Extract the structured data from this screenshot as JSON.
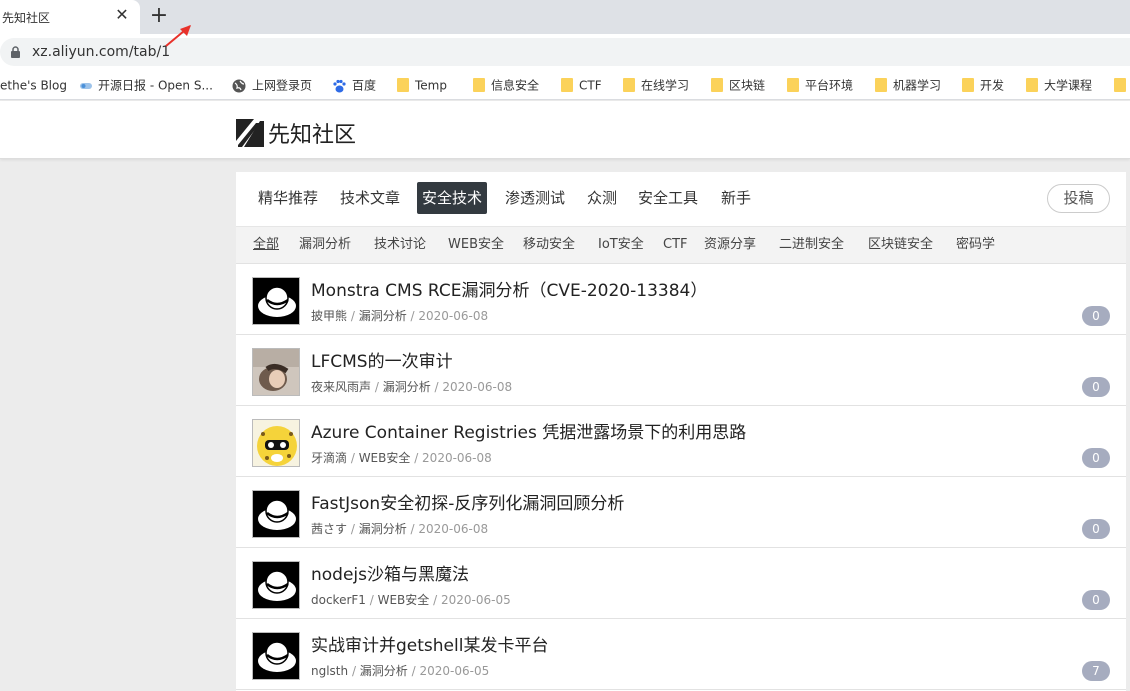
{
  "browser": {
    "tab_title": "先知社区",
    "tab_close": "✕",
    "new_tab": "+",
    "url": "xz.aliyun.com/tab/1",
    "bookmarks": [
      {
        "label": "ethe's Blog",
        "icon": "none"
      },
      {
        "label": "开源日报 - Open S...",
        "icon": "opensource-icon"
      },
      {
        "label": "上网登录页",
        "icon": "globe-icon"
      },
      {
        "label": "百度",
        "icon": "baidu-paw-icon"
      },
      {
        "label": "Temp",
        "icon": "folder-icon"
      },
      {
        "label": "信息安全",
        "icon": "folder-icon"
      },
      {
        "label": "CTF",
        "icon": "folder-icon"
      },
      {
        "label": "在线学习",
        "icon": "folder-icon"
      },
      {
        "label": "区块链",
        "icon": "folder-icon"
      },
      {
        "label": "平台环境",
        "icon": "folder-icon"
      },
      {
        "label": "机器学习",
        "icon": "folder-icon"
      },
      {
        "label": "开发",
        "icon": "folder-icon"
      },
      {
        "label": "大学课程",
        "icon": "folder-icon"
      }
    ]
  },
  "site": {
    "name": "先知社区"
  },
  "nav": {
    "items": [
      "精华推荐",
      "技术文章",
      "安全技术",
      "渗透测试",
      "众测",
      "安全工具",
      "新手"
    ],
    "active": "安全技术",
    "post_button": "投稿"
  },
  "subnav": {
    "items": [
      "全部",
      "漏洞分析",
      "技术讨论",
      "WEB安全",
      "移动安全",
      "IoT安全",
      "CTF",
      "资源分享",
      "二进制安全",
      "区块链安全",
      "密码学"
    ],
    "active": "全部"
  },
  "articles": [
    {
      "title": "Monstra CMS RCE漏洞分析（CVE-2020-13384）",
      "author": "披甲熊",
      "category": "漏洞分析",
      "date": "2020-06-08",
      "comments": "0",
      "avatar": "hat-avatar"
    },
    {
      "title": "LFCMS的一次审计",
      "author": "夜来风雨声",
      "category": "漏洞分析",
      "date": "2020-06-08",
      "comments": "0",
      "avatar": "photo-avatar"
    },
    {
      "title": "Azure Container Registries 凭据泄露场景下的利用思路",
      "author": "牙滴滴",
      "category": "WEB安全",
      "date": "2020-06-08",
      "comments": "0",
      "avatar": "cartoon-avatar"
    },
    {
      "title": "FastJson安全初探-反序列化漏洞回顾分析",
      "author": "茜さす",
      "category": "漏洞分析",
      "date": "2020-06-08",
      "comments": "0",
      "avatar": "hat-avatar"
    },
    {
      "title": "nodejs沙箱与黑魔法",
      "author": "dockerF1",
      "category": "WEB安全",
      "date": "2020-06-05",
      "comments": "0",
      "avatar": "hat-avatar"
    },
    {
      "title": "实战审计并getshell某发卡平台",
      "author": "nglsth",
      "category": "漏洞分析",
      "date": "2020-06-05",
      "comments": "7",
      "avatar": "hat-avatar"
    }
  ],
  "colors": {
    "active_nav_bg": "#333a40",
    "comment_badge": "#a6acbf",
    "folder": "#fbd25a",
    "arrow": "#e8312a"
  }
}
